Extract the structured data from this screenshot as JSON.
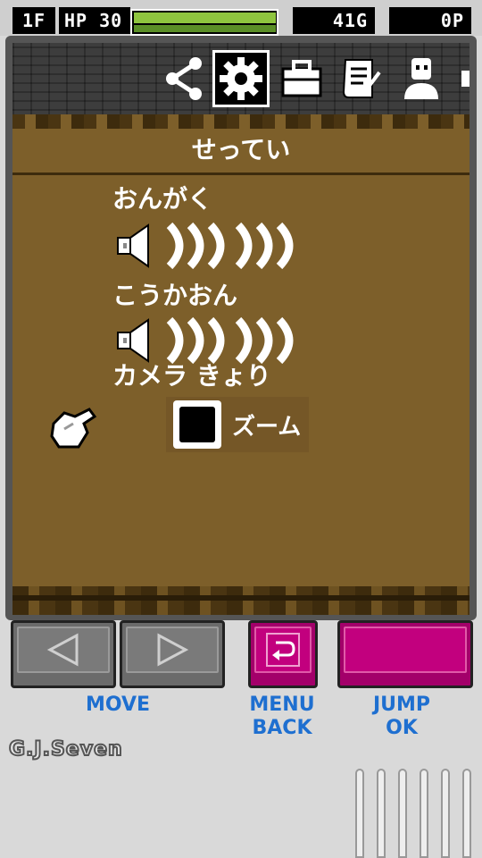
{
  "status": {
    "floor": "1F",
    "hp_label": "HP 30",
    "hp_fraction": 0.98,
    "gold": "41G",
    "points": "0P"
  },
  "menu": {
    "tabs": [
      {
        "icon": "share-icon",
        "active": false
      },
      {
        "icon": "gear-icon",
        "active": true
      },
      {
        "icon": "bag-icon",
        "active": false
      },
      {
        "icon": "scroll-icon",
        "active": false
      },
      {
        "icon": "person-icon",
        "active": false
      },
      {
        "icon": "key-icon",
        "active": false
      }
    ],
    "title": "せってい"
  },
  "settings": {
    "music": {
      "label": "おんがく",
      "level": 6,
      "max": 6
    },
    "sfx": {
      "label": "こうかおん",
      "level": 6,
      "max": 6
    },
    "camera": {
      "label": "カメラ きょり",
      "option_label": "ズーム",
      "checked": false
    }
  },
  "controls": {
    "move_caption": "MOVE",
    "menu_caption_1": "MENU",
    "menu_caption_2": "BACK",
    "jump_caption_1": "JUMP",
    "jump_caption_2": "OK"
  },
  "brand": {
    "logo_text": "G.J.Seven"
  },
  "colors": {
    "dirt": "#7d5f2a",
    "hp_bar": "#8fc53f",
    "accent_magenta": "#c2007e",
    "caption_blue": "#1e6fd0"
  }
}
